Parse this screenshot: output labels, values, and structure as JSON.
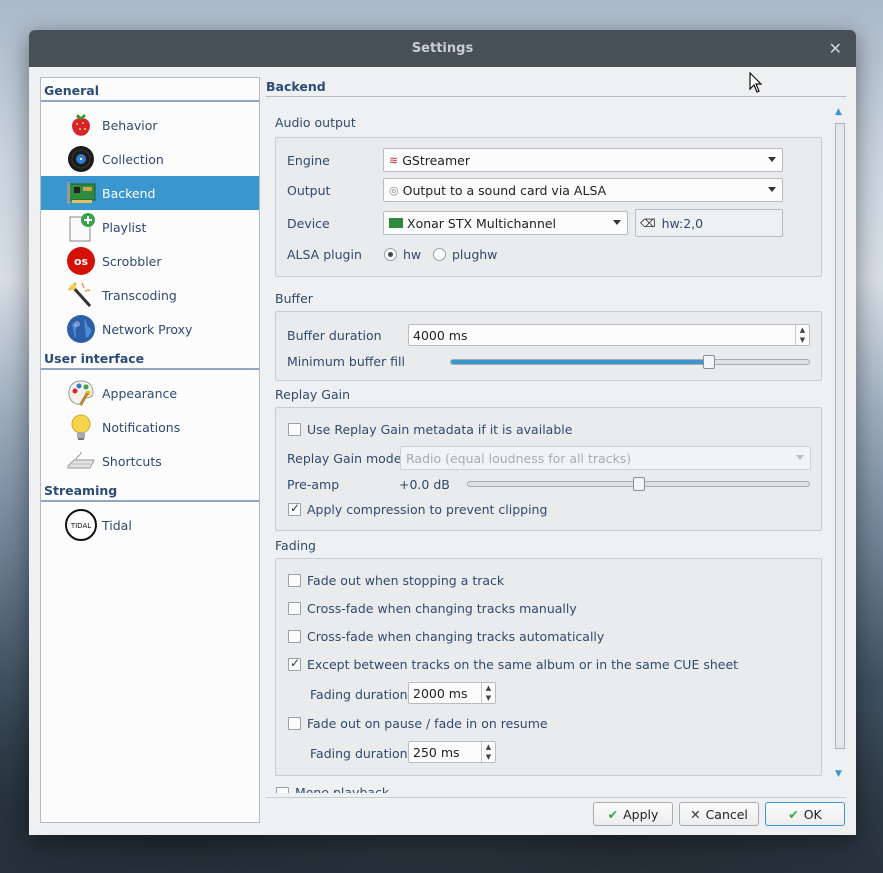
{
  "window": {
    "title": "Settings"
  },
  "sidebar": {
    "categories": [
      {
        "label": "General",
        "items": [
          {
            "label": "Behavior",
            "icon": "strawberry-icon"
          },
          {
            "label": "Collection",
            "icon": "vinyl-record-icon"
          },
          {
            "label": "Backend",
            "icon": "sound-card-icon",
            "selected": true
          },
          {
            "label": "Playlist",
            "icon": "playlist-add-icon"
          },
          {
            "label": "Scrobbler",
            "icon": "lastfm-icon"
          },
          {
            "label": "Transcoding",
            "icon": "wand-icon"
          },
          {
            "label": "Network Proxy",
            "icon": "globe-icon"
          }
        ]
      },
      {
        "label": "User interface",
        "items": [
          {
            "label": "Appearance",
            "icon": "palette-icon"
          },
          {
            "label": "Notifications",
            "icon": "lightbulb-icon"
          },
          {
            "label": "Shortcuts",
            "icon": "keyboard-icon"
          }
        ]
      },
      {
        "label": "Streaming",
        "items": [
          {
            "label": "Tidal",
            "icon": "tidal-icon",
            "icon_text": "TIDAL"
          }
        ]
      }
    ]
  },
  "page": {
    "title": "Backend",
    "audio_output": {
      "title": "Audio output",
      "engine_label": "Engine",
      "engine_value": "GStreamer",
      "output_label": "Output",
      "output_value": "Output to a sound card via ALSA",
      "device_label": "Device",
      "device_value": "Xonar STX Multichannel",
      "device_text": "hw:2,0",
      "alsa_label": "ALSA plugin",
      "alsa_hw": "hw",
      "alsa_plughw": "plughw"
    },
    "buffer": {
      "title": "Buffer",
      "duration_label": "Buffer duration",
      "duration_value": "4000 ms",
      "min_fill_label": "Minimum buffer fill",
      "min_fill_level": 0.72
    },
    "replay_gain": {
      "title": "Replay Gain",
      "use_metadata": "Use Replay Gain metadata if it is available",
      "mode_label": "Replay Gain mode",
      "mode_value": "Radio (equal loudness for all tracks)",
      "preamp_label": "Pre-amp",
      "preamp_value": "+0.0 dB",
      "preamp_level": 0.5,
      "compression": "Apply compression to prevent clipping"
    },
    "fading": {
      "title": "Fading",
      "fade_stop": "Fade out when stopping a track",
      "crossfade_manual": "Cross-fade when changing tracks manually",
      "crossfade_auto": "Cross-fade when changing tracks automatically",
      "except_album": "Except between tracks on the same album or in the same CUE sheet",
      "fading_duration_label": "Fading duration",
      "fading_duration_value": "2000 ms",
      "fade_pause": "Fade out on pause / fade in on resume",
      "pause_duration_label": "Fading duration",
      "pause_duration_value": "250 ms"
    },
    "cut_off_label": "Mono playback"
  },
  "buttons": {
    "apply": "Apply",
    "cancel": "Cancel",
    "ok": "OK"
  },
  "colors": {
    "selection": "#3a96cf",
    "titlebar": "#475057",
    "accent_text": "#2b4b78"
  }
}
